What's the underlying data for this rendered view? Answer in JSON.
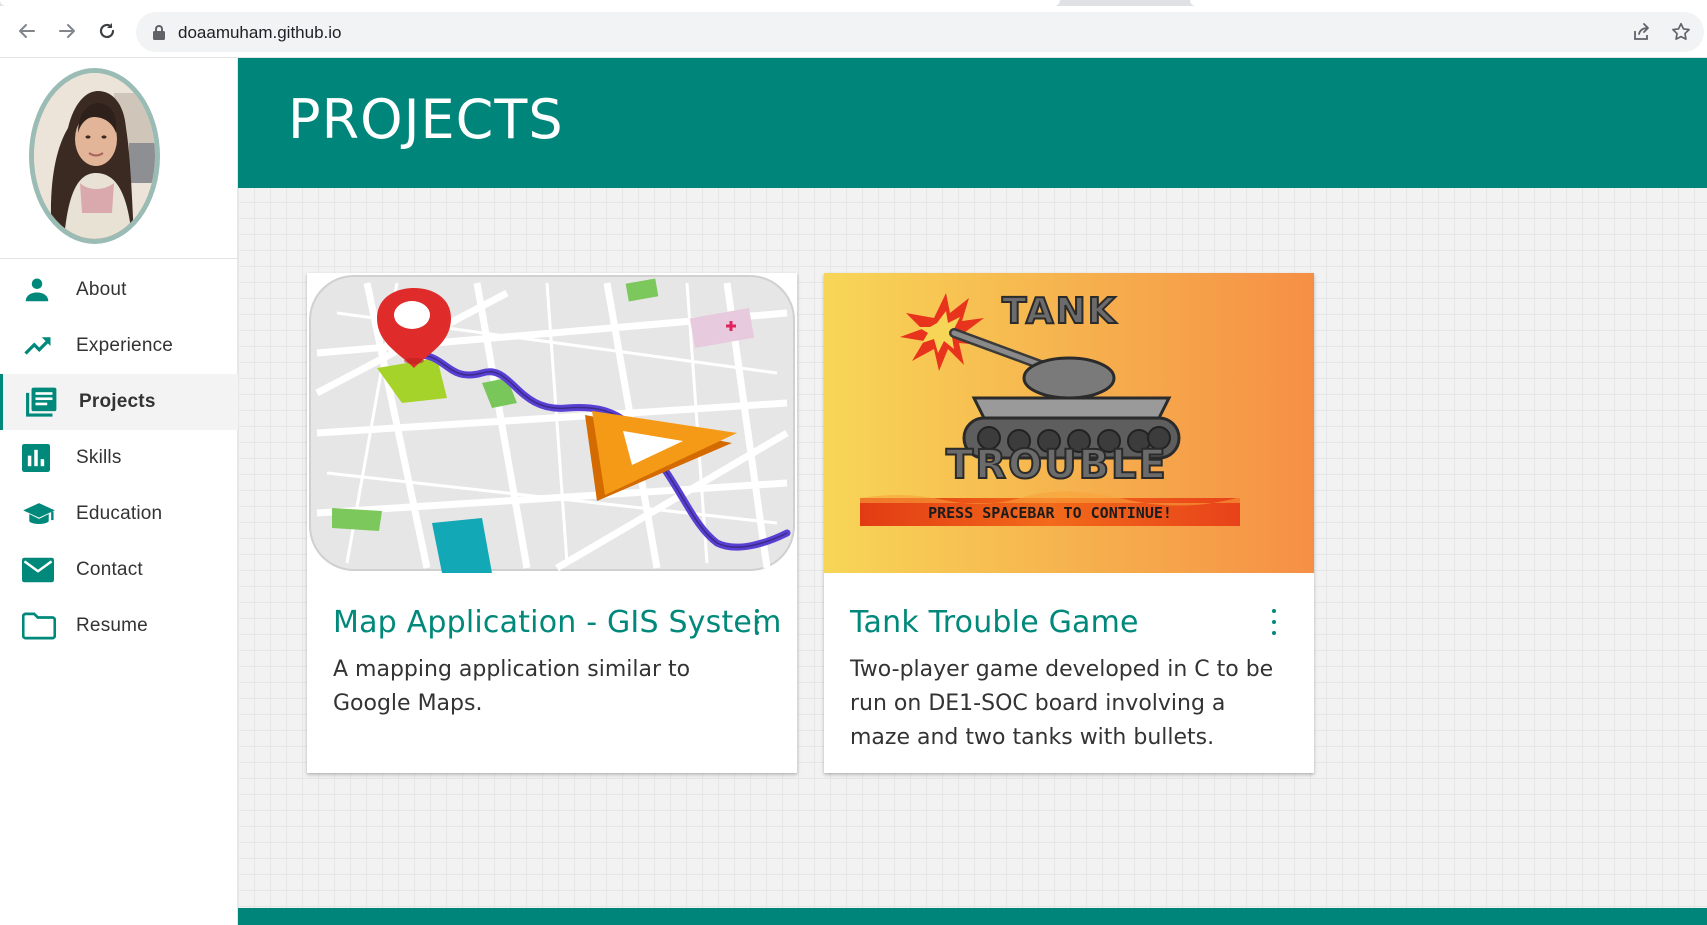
{
  "browser": {
    "url": "doaamuham.github.io",
    "icons": {
      "back": "arrow-left-icon",
      "forward": "arrow-right-icon",
      "reload": "reload-icon",
      "lock": "lock-icon",
      "share": "share-icon",
      "bookmark": "star-icon"
    }
  },
  "sidebar": {
    "items": [
      {
        "label": "About",
        "icon": "person-icon",
        "active": false
      },
      {
        "label": "Experience",
        "icon": "trending-up-icon",
        "active": false
      },
      {
        "label": "Projects",
        "icon": "article-icon",
        "active": true
      },
      {
        "label": "Skills",
        "icon": "bar-chart-icon",
        "active": false
      },
      {
        "label": "Education",
        "icon": "graduation-cap-icon",
        "active": false
      },
      {
        "label": "Contact",
        "icon": "mail-icon",
        "active": false
      },
      {
        "label": "Resume",
        "icon": "folder-icon",
        "active": false
      }
    ]
  },
  "header": {
    "title": "PROJECTS"
  },
  "projects": [
    {
      "title": "Map Application - GIS System",
      "description": "A mapping application similar to Google Maps."
    },
    {
      "title": "Tank Trouble Game",
      "description": "Two-player game developed in C to be run on DE1-SOC board involving a maze and two tanks with bullets.",
      "image_text": {
        "top": "TANK",
        "bottom": "TROUBLE",
        "banner": "PRESS SPACEBAR TO CONTINUE!"
      }
    }
  ],
  "colors": {
    "accent": "#00857a",
    "title": "#00897b"
  }
}
